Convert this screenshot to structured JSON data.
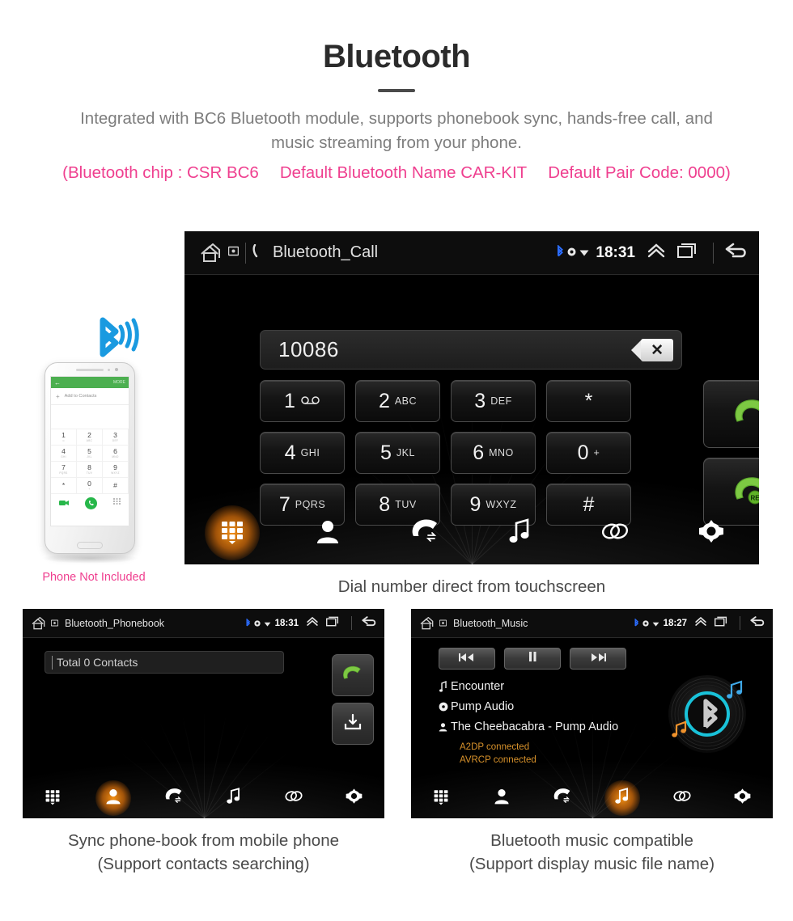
{
  "header": {
    "title": "Bluetooth",
    "subtitle_line1": "Integrated with BC6 Bluetooth module, supports phonebook sync, hands-free call, and",
    "subtitle_line2": "music streaming from your phone.",
    "chip_note": "(Bluetooth chip : CSR BC6",
    "name_note": "Default Bluetooth Name CAR-KIT",
    "pair_note": "Default Pair Code: 0000)",
    "accent_pink": "#ef3f8f",
    "accent_gray": "#7d7d7d"
  },
  "main_screen": {
    "statusbar": {
      "title": "Bluetooth_Call",
      "time": "18:31",
      "icons": [
        "home-icon",
        "device-icon",
        "phone-icon",
        "bluetooth-icon",
        "signal-dot-icon",
        "wifi-icon",
        "chevron-up-icon",
        "recent-apps-icon",
        "back-arrow-icon"
      ]
    },
    "dialer": {
      "number": "10086",
      "backspace_label": "✕",
      "keys": [
        {
          "digit": "1",
          "letters": "",
          "sub": "voicemail"
        },
        {
          "digit": "2",
          "letters": "ABC",
          "sub": ""
        },
        {
          "digit": "3",
          "letters": "DEF",
          "sub": ""
        },
        {
          "digit": "*",
          "letters": "",
          "sub": ""
        },
        {
          "digit": "4",
          "letters": "GHI",
          "sub": ""
        },
        {
          "digit": "5",
          "letters": "JKL",
          "sub": ""
        },
        {
          "digit": "6",
          "letters": "MNO",
          "sub": ""
        },
        {
          "digit": "0",
          "letters": "+",
          "sub": ""
        },
        {
          "digit": "7",
          "letters": "PQRS",
          "sub": ""
        },
        {
          "digit": "8",
          "letters": "TUV",
          "sub": ""
        },
        {
          "digit": "9",
          "letters": "WXYZ",
          "sub": ""
        },
        {
          "digit": "#",
          "letters": "",
          "sub": ""
        }
      ],
      "call_button": "call",
      "redial_button": "redial",
      "redial_badge": "RE"
    },
    "toolbar": [
      {
        "name": "keypad",
        "active": true
      },
      {
        "name": "contacts",
        "active": false
      },
      {
        "name": "call-history",
        "active": false
      },
      {
        "name": "music",
        "active": false
      },
      {
        "name": "pair-link",
        "active": false
      },
      {
        "name": "settings",
        "active": false
      }
    ],
    "caption": "Dial number direct from touchscreen"
  },
  "phonebook_screen": {
    "statusbar": {
      "title": "Bluetooth_Phonebook",
      "time": "18:31"
    },
    "search_value": "Total 0 Contacts",
    "side_buttons": [
      {
        "name": "call-button"
      },
      {
        "name": "download-phonebook-button"
      }
    ],
    "toolbar": [
      {
        "name": "keypad",
        "active": false
      },
      {
        "name": "contacts",
        "active": true
      },
      {
        "name": "call-history",
        "active": false
      },
      {
        "name": "music",
        "active": false
      },
      {
        "name": "pair-link",
        "active": false
      },
      {
        "name": "settings",
        "active": false
      }
    ],
    "caption_line1": "Sync phone-book from mobile phone",
    "caption_line2": "(Support contacts searching)"
  },
  "music_screen": {
    "statusbar": {
      "title": "Bluetooth_Music",
      "time": "18:27"
    },
    "controls": [
      {
        "name": "previous-track-button",
        "glyph": "◀◀"
      },
      {
        "name": "pause-button",
        "glyph": "‖"
      },
      {
        "name": "next-track-button",
        "glyph": "▶▶"
      }
    ],
    "track_title": "Encounter",
    "album": "Pump Audio",
    "artist": "The Cheebacabra - Pump Audio",
    "status_a2dp": "A2DP connected",
    "status_avrcp": "AVRCP connected",
    "status_color": "#d8922b",
    "toolbar": [
      {
        "name": "keypad",
        "active": false
      },
      {
        "name": "contacts",
        "active": false
      },
      {
        "name": "call-history",
        "active": false
      },
      {
        "name": "music",
        "active": true
      },
      {
        "name": "pair-link",
        "active": false
      },
      {
        "name": "settings",
        "active": false
      }
    ],
    "caption_line1": "Bluetooth music compatible",
    "caption_line2": "(Support display music file name)"
  },
  "phone_illustration": {
    "note": "Phone Not Included",
    "screen": {
      "more_label": "MORE",
      "add_contacts": "Add to Contacts",
      "keys": [
        {
          "n": "1",
          "s": "∞"
        },
        {
          "n": "2",
          "s": "ABC"
        },
        {
          "n": "3",
          "s": "DEF"
        },
        {
          "n": "4",
          "s": "GHI"
        },
        {
          "n": "5",
          "s": "JKL"
        },
        {
          "n": "6",
          "s": "MNO"
        },
        {
          "n": "7",
          "s": "PQRS"
        },
        {
          "n": "8",
          "s": "TUV"
        },
        {
          "n": "9",
          "s": "WXYZ"
        },
        {
          "n": "*",
          "s": ""
        },
        {
          "n": "0",
          "s": "+"
        },
        {
          "n": "#",
          "s": ""
        }
      ]
    },
    "bluetooth_color": "#1a9ae0"
  }
}
